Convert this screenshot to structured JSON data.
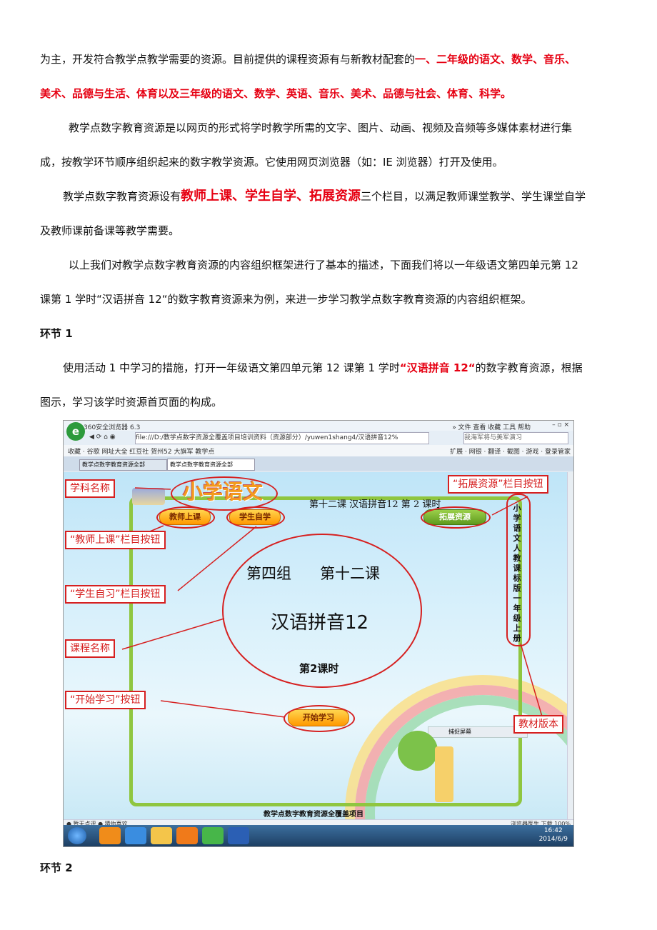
{
  "para1": {
    "a": "为主，开发符合教学点教学需要的资源。目前提供的课程资源有与新教材配套的",
    "b": "一、二年级的语文、数学、音乐、"
  },
  "para1b": "美术、品德与生活、体育以及三年级的语文、数学、英语、音乐、美术、品德与社会、体育、科学。",
  "para2a": "教学点数字教育资源是以网页的形式将学时教学所需的文字、图片、动画、视频及音频等多媒体素材进行集",
  "para2b": "成，按教学环节顺序组织起来的数字教学资源。它使用网页浏览器（如：IE 浏览器）打开及使用。",
  "para3": {
    "a": "教学点数字教育资源设有",
    "b": "教师上课、学生自学、拓展资源",
    "c": "三个栏目，以满足教师课堂教学、学生课堂自学"
  },
  "para3b": "及教师课前备课等教学需要。",
  "para4a": "以上我们对教学点数字教育资源的内容组织框架进行了基本的描述，下面我们将以一年级语文第四单元第 12",
  "para4b": "课第 1 学时“汉语拼音 12“的数字教育资源来为例，来进一步学习教学点数字教育资源的内容组织框架。",
  "heading1": "环节 1",
  "para5": {
    "a": "使用活动 1 中学习的措施，打开一年级语文第四单元第 12 课第 1 学时",
    "b": "“汉语拼音 12“",
    "c": "的数字教育资源，根据"
  },
  "para5b": "图示，学习该学时资源首页面的构成。",
  "heading2": "环节 2",
  "browser": {
    "title": "360安全浏览器 6.3",
    "menu": "» 文件 查看 收藏 工具 帮助",
    "address": "file:///D:/教学点数字资源全覆盖项目培训资料（资源部分）/yuwen1shang4/汉语拼音12%",
    "search": "我海军将与美军演习",
    "bookmarks": "收藏 · 谷歌 网址大全 红豆社 贺州52 大旗军 教学点",
    "tools": "扩展 · 网银 · 翻译 · 截图 · 游戏 · 登录管家",
    "tab1": "教学点数字教育资源全部",
    "tab2": "教学点数字教育资源全部",
    "status_left": "● 暂无点评  ● 猜你喜欢",
    "status_right": "浏览器医生  下载  100%",
    "time": "16:42",
    "date": "2014/6/9"
  },
  "page": {
    "logo": "小学语文",
    "lesson_title": "第十二课  汉语拼音12  第 2 课时",
    "btn_teacher": "教师上课",
    "btn_student": "学生自学",
    "btn_extend": "拓展资源",
    "group": "第四组      第十二课",
    "course": "汉语拼音12",
    "period": "第2课时",
    "start": "开始学习",
    "version": "小学语文人教课标版一年级上册",
    "capture": "捕捉屏幕",
    "footer": "教学点数字教育资源全覆盖项目"
  },
  "callouts": {
    "subject": "学科名称",
    "extend": "“拓展资源”栏目按钮",
    "teacher": "“教师上课”栏目按钮",
    "student": "“学生自习”栏目按钮",
    "course": "课程名称",
    "start": "“开始学习”按钮",
    "version": "教材版本"
  }
}
